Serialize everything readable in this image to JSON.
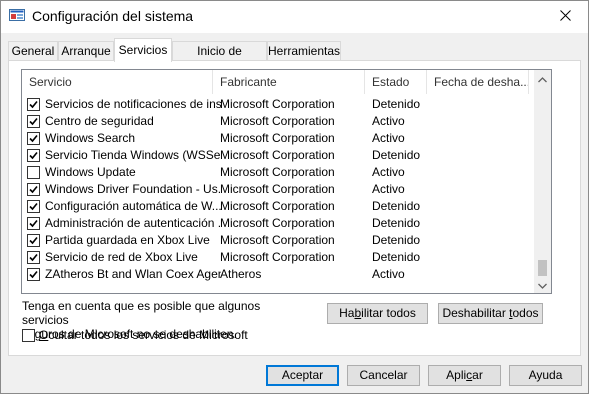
{
  "window": {
    "title": "Configuración del sistema",
    "icon": "msconfig-icon",
    "close_icon": "close-icon"
  },
  "tabs": [
    {
      "label": "General",
      "active": false
    },
    {
      "label": "Arranque",
      "active": false
    },
    {
      "label": "Servicios",
      "active": true
    },
    {
      "label": "Inicio de Windows",
      "active": false
    },
    {
      "label": "Herramientas",
      "active": false
    }
  ],
  "services": {
    "columns": {
      "name": "Servicio",
      "maker": "Fabricante",
      "state": "Estado",
      "date": "Fecha de desha..."
    },
    "rows": [
      {
        "checked": true,
        "name": "Servicios de notificaciones de ins...",
        "maker": "Microsoft Corporation",
        "state": "Detenido",
        "date": ""
      },
      {
        "checked": true,
        "name": "Centro de seguridad",
        "maker": "Microsoft Corporation",
        "state": "Activo",
        "date": ""
      },
      {
        "checked": true,
        "name": "Windows Search",
        "maker": "Microsoft Corporation",
        "state": "Activo",
        "date": ""
      },
      {
        "checked": true,
        "name": "Servicio Tienda Windows (WSSe...",
        "maker": "Microsoft Corporation",
        "state": "Detenido",
        "date": ""
      },
      {
        "checked": false,
        "name": "Windows Update",
        "maker": "Microsoft Corporation",
        "state": "Activo",
        "date": ""
      },
      {
        "checked": true,
        "name": "Windows Driver Foundation - Us...",
        "maker": "Microsoft Corporation",
        "state": "Activo",
        "date": ""
      },
      {
        "checked": true,
        "name": "Configuración automática de W...",
        "maker": "Microsoft Corporation",
        "state": "Detenido",
        "date": ""
      },
      {
        "checked": true,
        "name": "Administración de autenticación ...",
        "maker": "Microsoft Corporation",
        "state": "Detenido",
        "date": ""
      },
      {
        "checked": true,
        "name": "Partida guardada en Xbox Live",
        "maker": "Microsoft Corporation",
        "state": "Detenido",
        "date": ""
      },
      {
        "checked": true,
        "name": "Servicio de red de Xbox Live",
        "maker": "Microsoft Corporation",
        "state": "Detenido",
        "date": ""
      },
      {
        "checked": true,
        "name": "ZAtheros Bt and Wlan Coex Agent",
        "maker": "Atheros",
        "state": "Activo",
        "date": ""
      }
    ]
  },
  "note": {
    "line1": "Tenga en cuenta que es posible que algunos servicios",
    "line2": "seguros de Microsoft no se deshabiliten."
  },
  "buttons": {
    "enable_all_pre": "Ha",
    "enable_all_u": "b",
    "enable_all_post": "ilitar todos",
    "disable_all_pre": "Deshabilitar ",
    "disable_all_u": "t",
    "disable_all_post": "odos",
    "ok": "Aceptar",
    "cancel": "Cancelar",
    "apply_pre": "Apli",
    "apply_u": "c",
    "apply_post": "ar",
    "help": "Ayuda"
  },
  "hide_ms": {
    "checked": false,
    "label_u": "O",
    "label_rest": "cultar todos los servicios de Microsoft"
  },
  "colors": {
    "default_button_border": "#0078d7",
    "window_bg": "#f0f0f0"
  }
}
